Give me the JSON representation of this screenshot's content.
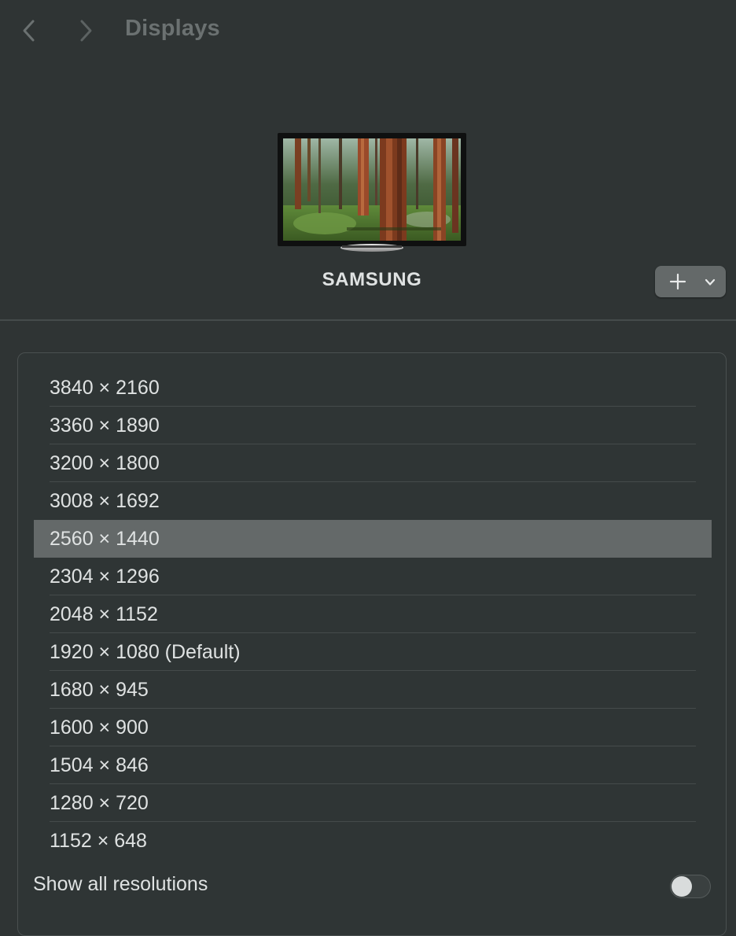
{
  "window": {
    "title": "Displays"
  },
  "display": {
    "name": "SAMSUNG"
  },
  "resolutions": [
    {
      "label": "3840 × 2160",
      "selected": false
    },
    {
      "label": "3360 × 1890",
      "selected": false
    },
    {
      "label": "3200 × 1800",
      "selected": false
    },
    {
      "label": "3008 × 1692",
      "selected": false
    },
    {
      "label": "2560 × 1440",
      "selected": true
    },
    {
      "label": "2304 × 1296",
      "selected": false
    },
    {
      "label": "2048 × 1152",
      "selected": false
    },
    {
      "label": "1920 × 1080 (Default)",
      "selected": false
    },
    {
      "label": "1680 × 945",
      "selected": false
    },
    {
      "label": "1600 × 900",
      "selected": false
    },
    {
      "label": "1504 × 846",
      "selected": false
    },
    {
      "label": "1280 × 720",
      "selected": false
    },
    {
      "label": "1152 × 648",
      "selected": false
    }
  ],
  "show_all": {
    "label": "Show all resolutions",
    "enabled": false
  },
  "icons": {
    "back": "chevron-left-icon",
    "forward": "chevron-right-icon",
    "add": "plus-icon",
    "menu": "chevron-down-icon"
  },
  "colors": {
    "background": "#2f3434",
    "selected_row": "#646969",
    "text": "#dfe2e2",
    "title_dim": "#6b7171"
  }
}
